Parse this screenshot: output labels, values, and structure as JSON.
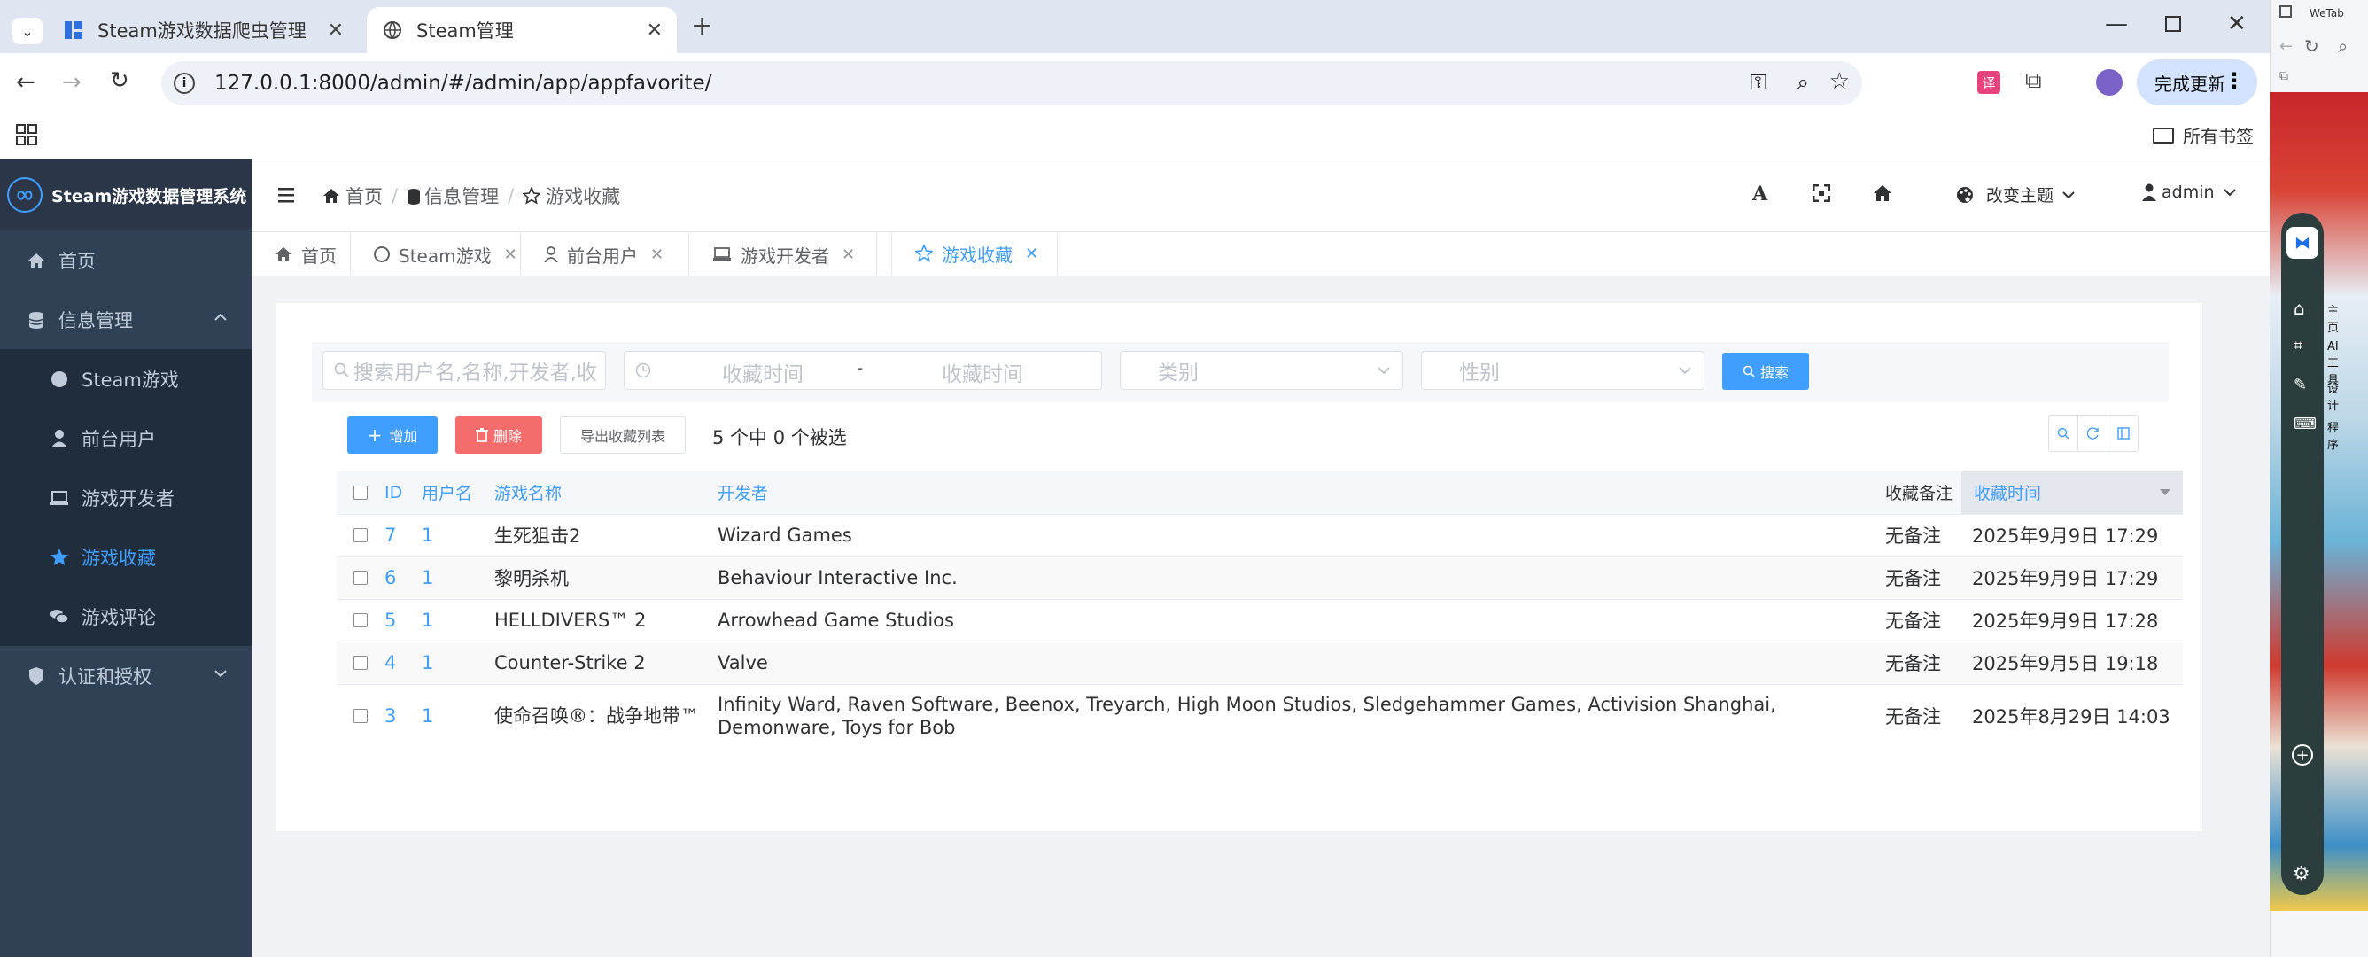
{
  "browser": {
    "tabs": [
      {
        "title": "Steam游戏数据爬虫管理"
      },
      {
        "title": "Steam管理"
      }
    ],
    "address": "127.0.0.1:8000/admin/#/admin/app/appfavorite/",
    "update_label": "完成更新",
    "bookmarks_label": "所有书签",
    "sidepanel_top": "WeTab",
    "side_labels": [
      "主页",
      "AI工具",
      "设计",
      "程序"
    ]
  },
  "app": {
    "system_name": "Steam游戏数据管理系统",
    "sidebar": {
      "home": "首页",
      "info_group": "信息管理",
      "items": [
        {
          "label": "Steam游戏"
        },
        {
          "label": "前台用户"
        },
        {
          "label": "游戏开发者"
        },
        {
          "label": "游戏收藏"
        },
        {
          "label": "游戏评论"
        }
      ],
      "auth_group": "认证和授权"
    },
    "header": {
      "breadcrumbs": [
        "首页",
        "信息管理",
        "游戏收藏"
      ],
      "theme_label": "改变主题",
      "user": "admin"
    },
    "view_tabs": [
      {
        "label": "首页"
      },
      {
        "label": "Steam游戏"
      },
      {
        "label": "前台用户"
      },
      {
        "label": "游戏开发者"
      },
      {
        "label": "游戏收藏"
      }
    ],
    "filters": {
      "search_placeholder": "搜索用户名,名称,开发者,收",
      "date_start": "收藏时间",
      "date_sep": "-",
      "date_end": "收藏时间",
      "category": "类别",
      "gender": "性别",
      "search_button": "搜索"
    },
    "actions": {
      "add": "增加",
      "delete": "删除",
      "export": "导出收藏列表",
      "selection": "5 个中 0 个被选"
    },
    "table": {
      "columns": [
        "ID",
        "用户名",
        "游戏名称",
        "开发者",
        "收藏备注",
        "收藏时间"
      ],
      "rows": [
        {
          "id": "7",
          "user": "1",
          "game": "生死狙击2",
          "dev": "Wizard Games",
          "note": "无备注",
          "time": "2025年9月9日 17:29"
        },
        {
          "id": "6",
          "user": "1",
          "game": "黎明杀机",
          "dev": "Behaviour Interactive Inc.",
          "note": "无备注",
          "time": "2025年9月9日 17:29"
        },
        {
          "id": "5",
          "user": "1",
          "game": "HELLDIVERS™ 2",
          "dev": "Arrowhead Game Studios",
          "note": "无备注",
          "time": "2025年9月9日 17:28"
        },
        {
          "id": "4",
          "user": "1",
          "game": "Counter-Strike 2",
          "dev": "Valve",
          "note": "无备注",
          "time": "2025年9月5日 19:18"
        },
        {
          "id": "3",
          "user": "1",
          "game": "使命召唤®：战争地带™",
          "dev": "Infinity Ward, Raven Software, Beenox, Treyarch, High Moon Studios, Sledgehammer Games, Activision Shanghai, Demonware, Toys for Bob",
          "note": "无备注",
          "time": "2025年8月29日 14:03"
        }
      ]
    }
  },
  "colors": {
    "sidebar": "#304156",
    "accent": "#409eff",
    "danger": "#f56c6c"
  }
}
